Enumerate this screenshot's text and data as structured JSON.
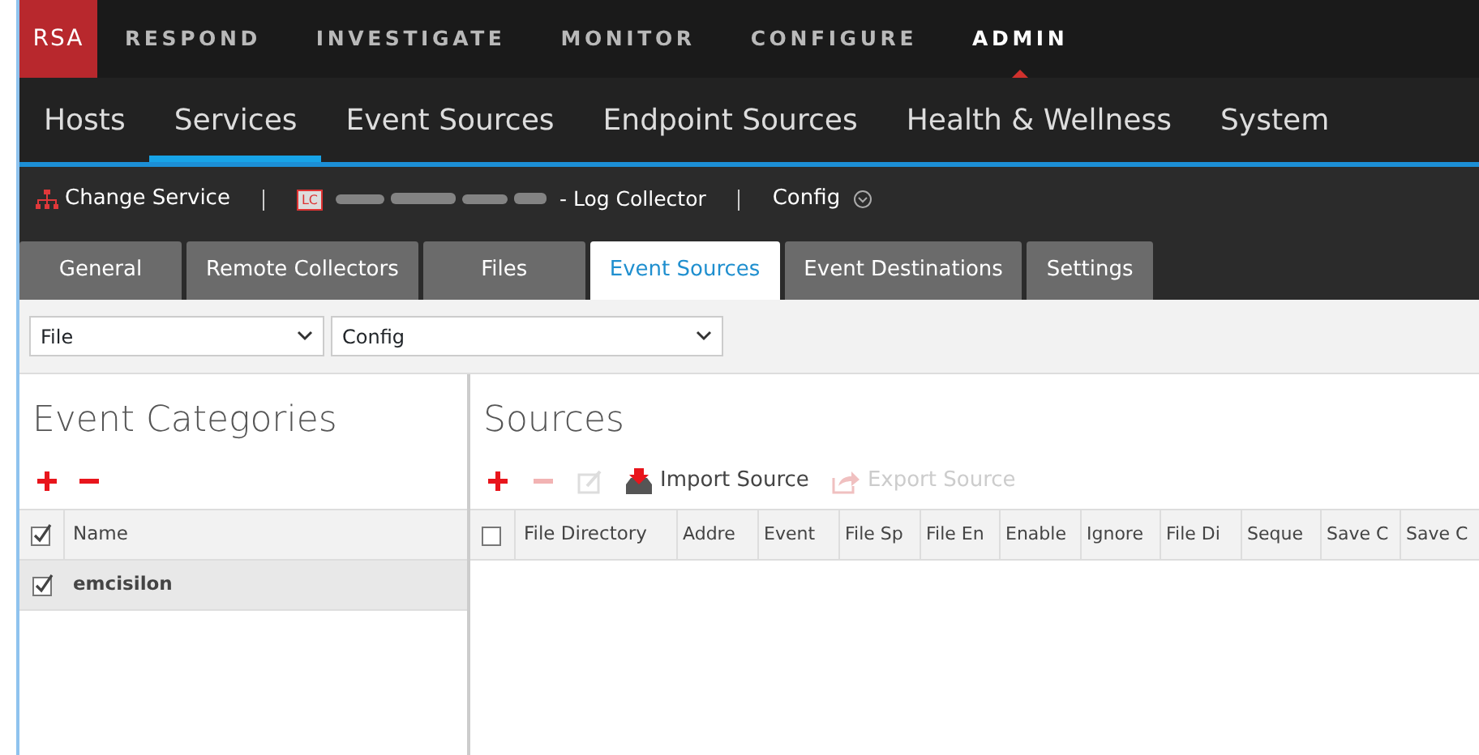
{
  "top_nav": [
    {
      "label": "RESPOND",
      "selected": false
    },
    {
      "label": "INVESTIGATE",
      "selected": false
    },
    {
      "label": "MONITOR",
      "selected": false
    },
    {
      "label": "CONFIGURE",
      "selected": false
    },
    {
      "label": "ADMIN",
      "selected": true
    }
  ],
  "logo": "RSA",
  "sub_nav": [
    {
      "label": "Hosts",
      "selected": false
    },
    {
      "label": "Services",
      "selected": true
    },
    {
      "label": "Event Sources",
      "selected": false
    },
    {
      "label": "Endpoint Sources",
      "selected": false
    },
    {
      "label": "Health & Wellness",
      "selected": false
    },
    {
      "label": "System",
      "selected": false
    }
  ],
  "service_bar": {
    "change_service": "Change Service",
    "badge": "LC",
    "service_suffix": "- Log Collector",
    "view": "Config"
  },
  "tabs": [
    {
      "label": "General",
      "selected": false
    },
    {
      "label": "Remote Collectors",
      "selected": false
    },
    {
      "label": "Files",
      "selected": false
    },
    {
      "label": "Event Sources",
      "selected": true
    },
    {
      "label": "Event Destinations",
      "selected": false
    },
    {
      "label": "Settings",
      "selected": false
    }
  ],
  "filters": [
    {
      "value": "File"
    },
    {
      "value": "Config"
    }
  ],
  "categories": {
    "title": "Event Categories",
    "tools": [
      {
        "kind": "add",
        "disabled": false
      },
      {
        "kind": "remove",
        "disabled": false
      }
    ],
    "header": {
      "label": "Name",
      "checked": true
    },
    "rows": [
      {
        "name": "emcisilon",
        "checked": true,
        "selected": true
      }
    ]
  },
  "sources": {
    "title": "Sources",
    "tools": [
      {
        "kind": "add",
        "disabled": false
      },
      {
        "kind": "remove",
        "disabled": true
      },
      {
        "kind": "edit",
        "disabled": true
      },
      {
        "kind": "import",
        "label": "Import Source",
        "disabled": false
      },
      {
        "kind": "export",
        "label": "Export Source",
        "disabled": true
      }
    ],
    "header_checked": false,
    "columns": [
      "File Directory",
      "Addre",
      "Event",
      "File Sp",
      "File En",
      "Enable",
      "Ignore",
      "File Di",
      "Seque",
      "Save C",
      "Save C"
    ]
  }
}
